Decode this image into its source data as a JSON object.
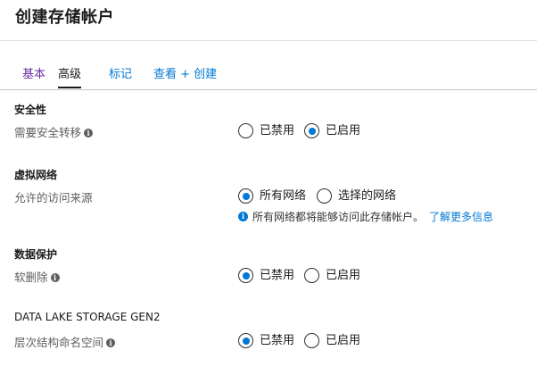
{
  "header": {
    "title": "创建存储帐户"
  },
  "tabs": [
    {
      "label": "基本"
    },
    {
      "label": "高级"
    },
    {
      "label": "标记"
    },
    {
      "label": "查看 + 创建"
    }
  ],
  "active_tab": "高级",
  "sections": {
    "security": {
      "title": "安全性",
      "field_label": "需要安全转移",
      "options": [
        "已禁用",
        "已启用"
      ],
      "selected": "已启用"
    },
    "vnet": {
      "title": "虚拟网络",
      "field_label": "允许的访问来源",
      "options": [
        "所有网络",
        "选择的网络"
      ],
      "selected": "所有网络",
      "note": "所有网络都将能够访问此存储帐户。",
      "note_link": "了解更多信息"
    },
    "data_protection": {
      "title": "数据保护",
      "field_label": "软删除",
      "options": [
        "已禁用",
        "已启用"
      ],
      "selected": "已禁用"
    },
    "data_lake": {
      "title": "DATA LAKE STORAGE GEN2",
      "field_label": "层次结构命名空间",
      "options": [
        "已禁用",
        "已启用"
      ],
      "selected": "已禁用"
    }
  },
  "colors": {
    "accent": "#0078d4",
    "visited_tab": "#6b2fa3",
    "text": "#1b1b1b",
    "muted": "#605e5c"
  },
  "icons": {
    "info": "info-icon",
    "note_info": "info-circle-icon"
  }
}
